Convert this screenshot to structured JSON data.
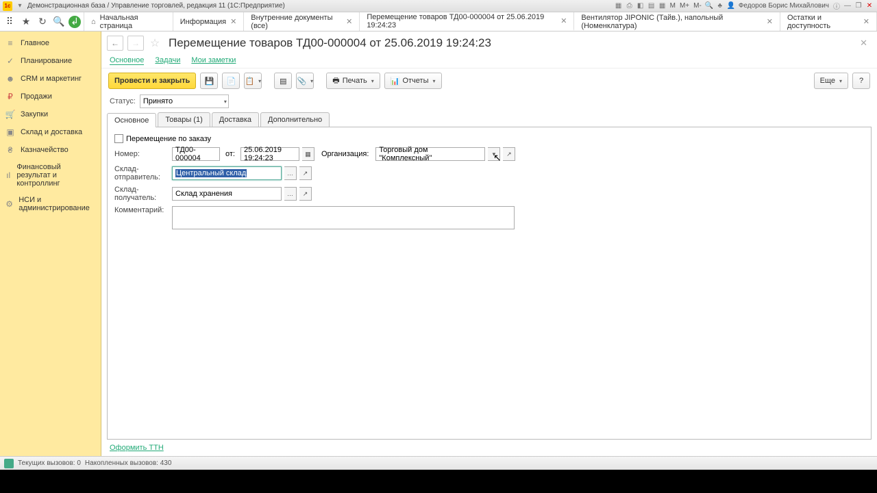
{
  "titlebar": {
    "logo": "1c",
    "title": "Демонстрационная база / Управление торговлей, редакция 11  (1С:Предприятие)",
    "user": "Федоров Борис Михайлович",
    "m_labels": [
      "M",
      "M+",
      "M-"
    ]
  },
  "main_tabs": [
    {
      "label": "Начальная страница",
      "home": true,
      "closable": false
    },
    {
      "label": "Информация",
      "closable": true
    },
    {
      "label": "Внутренние документы (все)",
      "closable": true
    },
    {
      "label": "Перемещение товаров ТД00-000004 от 25.06.2019 19:24:23",
      "closable": true,
      "active": true
    },
    {
      "label": "Вентилятор JIPONIC (Тайв.), напольный (Номенклатура)",
      "closable": true
    },
    {
      "label": "Остатки и доступность",
      "closable": true
    }
  ],
  "sidebar": [
    {
      "icon": "≡",
      "label": "Главное"
    },
    {
      "icon": "✓",
      "label": "Планирование"
    },
    {
      "icon": "☻",
      "label": "CRM и маркетинг"
    },
    {
      "icon": "₽",
      "label": "Продажи",
      "icon_color": "red"
    },
    {
      "icon": "🛒",
      "label": "Закупки"
    },
    {
      "icon": "▣",
      "label": "Склад и доставка"
    },
    {
      "icon": "₴",
      "label": "Казначейство"
    },
    {
      "icon": "ıl",
      "label": "Финансовый результат и контроллинг"
    },
    {
      "icon": "⚙",
      "label": "НСИ и администрирование"
    }
  ],
  "doc": {
    "title": "Перемещение товаров ТД00-000004 от 25.06.2019 19:24:23",
    "subnav": {
      "main": "Основное",
      "tasks": "Задачи",
      "notes": "Мои заметки"
    },
    "toolbar": {
      "post_close": "Провести и закрыть",
      "print": "Печать",
      "reports": "Отчеты",
      "more": "Еще",
      "help": "?"
    },
    "status_label": "Статус:",
    "status_value": "Принято",
    "form_tabs": [
      "Основное",
      "Товары (1)",
      "Доставка",
      "Дополнительно"
    ],
    "form": {
      "by_order_label": "Перемещение по заказу",
      "number_label": "Номер:",
      "number_value": "ТД00-000004",
      "date_label": "от:",
      "date_value": "25.06.2019 19:24:23",
      "org_label": "Организация:",
      "org_value": "Торговый дом \"Комплексный\"",
      "from_label": "Склад-отправитель:",
      "from_value": "Центральный склад",
      "to_label": "Склад-получатель:",
      "to_value": "Склад хранения",
      "comment_label": "Комментарий:"
    },
    "footer_link": "Оформить ТТН"
  },
  "statusbar": {
    "calls": "Текущих вызовов: 0",
    "accum": "Накопленных вызовов: 430"
  }
}
